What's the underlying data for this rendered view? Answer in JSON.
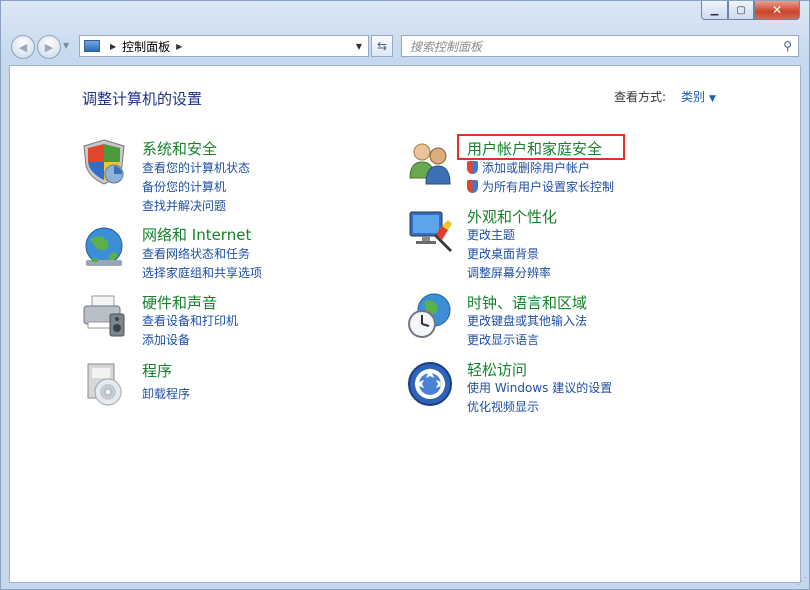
{
  "window": {
    "minimize_icon": "minimize-icon",
    "maximize_icon": "maximize-icon",
    "close_icon": "close-icon",
    "close_glyph": "✕"
  },
  "nav": {
    "address_breadcrumb": "控制面板",
    "search_placeholder": "搜索控制面板"
  },
  "header": {
    "title": "调整计算机的设置",
    "view_by_label": "查看方式:",
    "view_by_value": "类别"
  },
  "categories": [
    {
      "title": "系统和安全",
      "icon": "system-security-icon",
      "links": [
        "查看您的计算机状态",
        "备份您的计算机",
        "查找并解决问题"
      ]
    },
    {
      "title": "网络和 Internet",
      "icon": "network-internet-icon",
      "links": [
        "查看网络状态和任务",
        "选择家庭组和共享选项"
      ]
    },
    {
      "title": "硬件和声音",
      "icon": "hardware-sound-icon",
      "links": [
        "查看设备和打印机",
        "添加设备"
      ]
    },
    {
      "title": "程序",
      "icon": "programs-icon",
      "links": [
        "卸载程序"
      ]
    },
    {
      "title": "用户帐户和家庭安全",
      "icon": "user-accounts-icon",
      "links": [
        "添加或删除用户帐户",
        "为所有用户设置家长控制"
      ]
    },
    {
      "title": "外观和个性化",
      "icon": "appearance-icon",
      "links": [
        "更改主题",
        "更改桌面背景",
        "调整屏幕分辨率"
      ]
    },
    {
      "title": "时钟、语言和区域",
      "icon": "clock-language-region-icon",
      "links": [
        "更改键盘或其他输入法",
        "更改显示语言"
      ]
    },
    {
      "title": "轻松访问",
      "icon": "ease-of-access-icon",
      "links": [
        "使用 Windows 建议的设置",
        "优化视频显示"
      ]
    }
  ],
  "colors": {
    "category_title": "#16822b",
    "link": "#1f4fa6",
    "heading": "#1e3287",
    "highlight_border": "#e0322b"
  }
}
